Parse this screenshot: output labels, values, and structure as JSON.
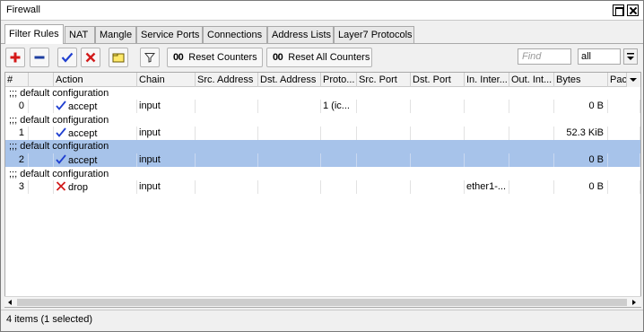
{
  "window": {
    "title": "Firewall"
  },
  "tabs": [
    {
      "label": "Filter Rules",
      "active": true
    },
    {
      "label": "NAT"
    },
    {
      "label": "Mangle"
    },
    {
      "label": "Service Ports"
    },
    {
      "label": "Connections"
    },
    {
      "label": "Address Lists"
    },
    {
      "label": "Layer7 Protocols"
    }
  ],
  "toolbar": {
    "add_icon": "plus-icon",
    "remove_icon": "minus-icon",
    "enable_icon": "check-icon",
    "disable_icon": "x-icon",
    "comment_icon": "note-icon",
    "filter_icon": "funnel-icon",
    "reset_counters_prefix": "00",
    "reset_counters_label": "Reset Counters",
    "reset_all_prefix": "00",
    "reset_all_label": "Reset All Counters",
    "find_placeholder": "Find",
    "filter_value": "all"
  },
  "table": {
    "columns": [
      "#",
      "",
      "Action",
      "Chain",
      "Src. Address",
      "Dst. Address",
      "Proto...",
      "Src. Port",
      "Dst. Port",
      "In. Inter...",
      "Out. Int...",
      "Bytes",
      "Pac"
    ],
    "rows": [
      {
        "comment": ";;; default configuration",
        "num": "0",
        "action": "accept",
        "chain": "input",
        "proto": "1 (ic...",
        "in_iface": "",
        "bytes": "0 B",
        "selected": false
      },
      {
        "comment": ";;; default configuration",
        "num": "1",
        "action": "accept",
        "chain": "input",
        "proto": "",
        "in_iface": "",
        "bytes": "52.3 KiB",
        "selected": false
      },
      {
        "comment": ";;; default configuration",
        "num": "2",
        "action": "accept",
        "chain": "input",
        "proto": "",
        "in_iface": "",
        "bytes": "0 B",
        "selected": true
      },
      {
        "comment": ";;; default configuration",
        "num": "3",
        "action": "drop",
        "chain": "input",
        "proto": "",
        "in_iface": "ether1-...",
        "bytes": "0 B",
        "selected": false
      }
    ]
  },
  "status": {
    "text": "4 items (1 selected)"
  },
  "colors": {
    "selection": "#a7c3ea",
    "accept_check": "#1f3fd0",
    "drop_x": "#d21b1b",
    "add_red": "#d41818",
    "remove_blue": "#1e3fa0"
  }
}
